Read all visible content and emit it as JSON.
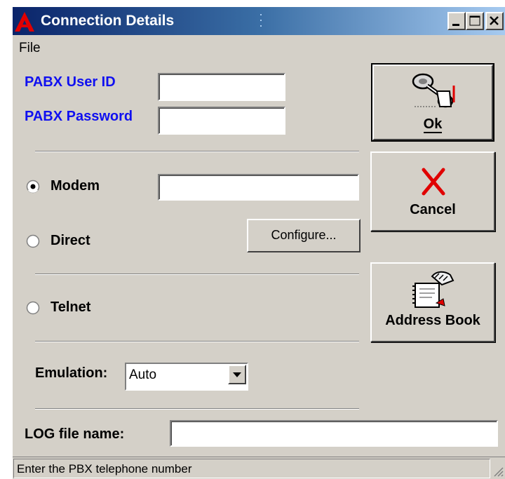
{
  "window": {
    "title": "Connection Details",
    "icon": "alcatel-a-icon"
  },
  "menu": {
    "file_label": "File"
  },
  "credentials": {
    "user_id_label": "PABX User ID",
    "user_id_value": "",
    "password_label": "PABX Password",
    "password_value": ""
  },
  "connection": {
    "modem_label": "Modem",
    "modem_selected": true,
    "modem_number": "",
    "direct_label": "Direct",
    "direct_selected": false,
    "configure_label": "Configure...",
    "telnet_label": "Telnet",
    "telnet_selected": false
  },
  "emulation": {
    "label": "Emulation:",
    "value": "Auto"
  },
  "log": {
    "label": "LOG file name:",
    "value": ""
  },
  "buttons": {
    "ok_label": "Ok",
    "cancel_label": "Cancel",
    "address_book_label": "Address Book"
  },
  "status": {
    "text": "Enter the PBX telephone number"
  },
  "colors": {
    "label_blue": "#1010f0",
    "titlebar_start": "#0a246a",
    "face": "#d4d0c8",
    "cancel_red": "#e00000"
  }
}
